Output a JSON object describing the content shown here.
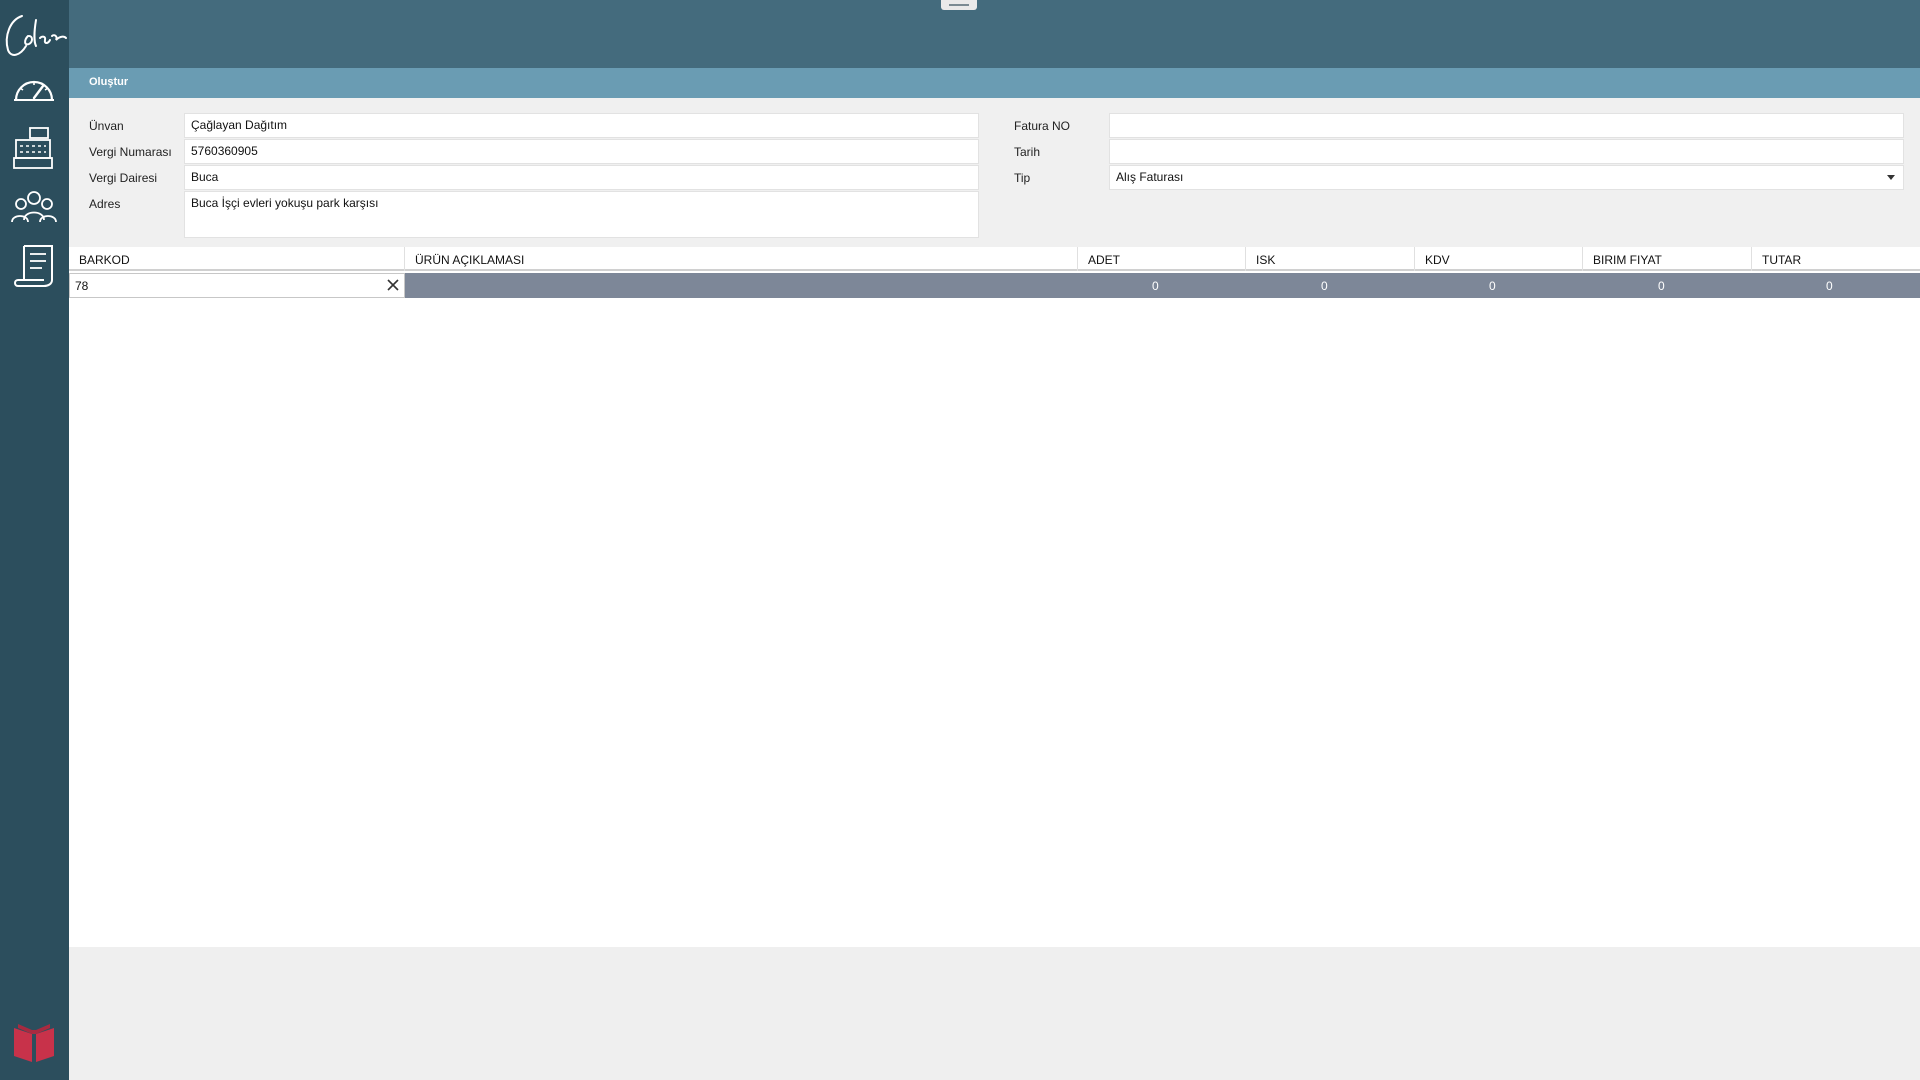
{
  "header": {
    "section_title": "Oluştur"
  },
  "sidebar": {
    "items": [
      {
        "icon": "dashboard-gauge-icon"
      },
      {
        "icon": "cash-register-icon"
      },
      {
        "icon": "customers-group-icon"
      },
      {
        "icon": "invoice-document-icon"
      }
    ],
    "bottom_icon": "book-icon"
  },
  "form": {
    "unvan_label": "Ünvan",
    "unvan_value": "Çağlayan Dağıtım",
    "vergi_no_label": "Vergi Numarası",
    "vergi_no_value": "5760360905",
    "vergi_dairesi_label": "Vergi Dairesi",
    "vergi_dairesi_value": "Buca",
    "adres_label": "Adres",
    "adres_value": "Buca İşçi evleri yokuşu park karşısı",
    "fatura_no_label": "Fatura NO",
    "fatura_no_value": "",
    "tarih_label": "Tarih",
    "tarih_value": "",
    "tip_label": "Tip",
    "tip_value": "Alış Faturası"
  },
  "grid": {
    "columns": [
      "BARKOD",
      "ÜRÜN AÇIKLAMASI",
      "ADET",
      "ISK",
      "KDV",
      "BIRIM FIYAT",
      "TUTAR"
    ],
    "row": {
      "barkod": "78",
      "urun_aciklamasi": "",
      "adet": "0",
      "isk": "0",
      "kdv": "0",
      "birim_fiyat": "0",
      "tutar": "0"
    }
  },
  "colors": {
    "sidebar": "#2c4e5d",
    "topbar": "#446b7d",
    "section_bar": "#6a9cb3",
    "selected_row": "#7d8798",
    "accent_red": "#c8324a"
  }
}
